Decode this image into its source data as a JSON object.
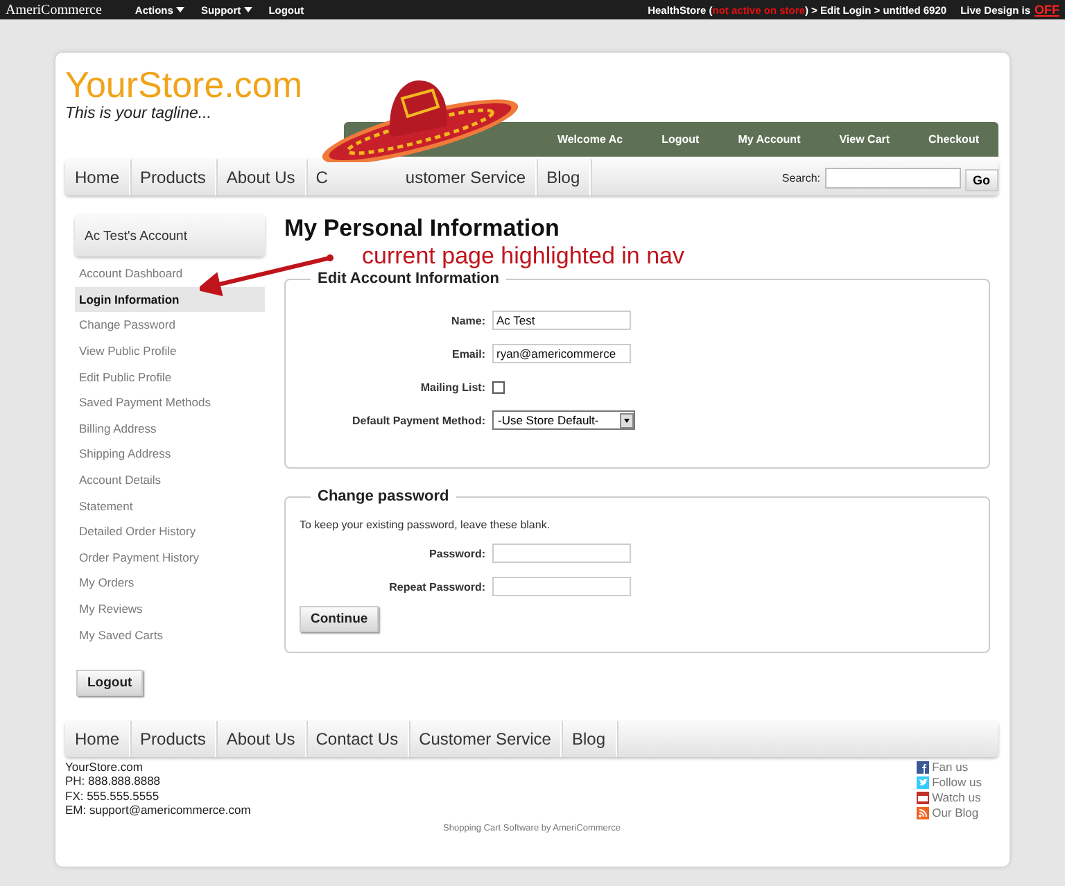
{
  "top_bar": {
    "brand": "AmeriCommerce",
    "menus": [
      {
        "label": "Actions",
        "kind": "dropdown"
      },
      {
        "label": "Support",
        "kind": "dropdown"
      },
      {
        "label": "Logout",
        "kind": "link"
      }
    ],
    "breadcrumb": [
      {
        "text": "HealthStore (",
        "kind": "plain"
      },
      {
        "text": "not active on store",
        "kind": "alert"
      },
      {
        "text": ") > Edit Login > untitled 6920",
        "kind": "plain"
      }
    ],
    "live_design": {
      "label": "Live Design is",
      "value": "OFF"
    }
  },
  "header": {
    "logo": "YourStore.com",
    "tagline": "This is your tagline...",
    "account_links": [
      "Welcome Ac",
      "Logout",
      "My Account",
      "View Cart",
      "Checkout"
    ]
  },
  "nav": {
    "items": [
      "Home",
      "Products",
      "About Us",
      "C",
      "ustomer Service",
      "Blog"
    ],
    "search_label": "Search:",
    "search_button": "Go"
  },
  "sidebar": {
    "title": "Ac Test's Account",
    "items": [
      {
        "label": "Account Dashboard",
        "selected": false
      },
      {
        "label": "Login Information",
        "selected": true
      },
      {
        "label": "Change Password",
        "selected": false
      },
      {
        "label": "View Public Profile",
        "selected": false
      },
      {
        "label": "Edit Public Profile",
        "selected": false
      },
      {
        "label": "Saved Payment Methods",
        "selected": false
      },
      {
        "label": "Billing Address",
        "selected": false
      },
      {
        "label": "Shipping Address",
        "selected": false
      },
      {
        "label": "Account Details",
        "selected": false
      },
      {
        "label": "Statement",
        "selected": false
      },
      {
        "label": "Detailed Order History",
        "selected": false
      },
      {
        "label": "Order Payment History",
        "selected": false
      },
      {
        "label": "My Orders",
        "selected": false
      },
      {
        "label": "My Reviews",
        "selected": false
      },
      {
        "label": "My Saved Carts",
        "selected": false
      }
    ],
    "logout": "Logout"
  },
  "annotation": "current page highlighted in nav",
  "main": {
    "title": "My Personal Information",
    "account_section": {
      "legend": "Edit Account Information",
      "fields": [
        {
          "label": "Name:",
          "kind": "text",
          "value": "Ac Test"
        },
        {
          "label": "Email:",
          "kind": "text",
          "value": "ryan@americommerce"
        },
        {
          "label": "Mailing List:",
          "kind": "checkbox",
          "checked": false
        },
        {
          "label": "Default Payment Method:",
          "kind": "select",
          "value": "-Use Store Default-"
        }
      ]
    },
    "password_section": {
      "legend": "Change password",
      "hint": "To keep your existing password, leave these blank.",
      "fields": [
        {
          "label": "Password:",
          "kind": "password"
        },
        {
          "label": "Repeat Password:",
          "kind": "password"
        }
      ],
      "button": "Continue"
    }
  },
  "footer": {
    "nav": [
      "Home",
      "Products",
      "About Us",
      "Contact Us",
      "Customer Service",
      "Blog"
    ],
    "contact": [
      "YourStore.com",
      "PH: 888.888.8888",
      "FX: 555.555.5555",
      "EM: support@americommerce.com"
    ],
    "social": [
      {
        "label": "Fan us",
        "kind": "facebook"
      },
      {
        "label": "Follow us",
        "kind": "twitter"
      },
      {
        "label": "Watch us",
        "kind": "youtube"
      },
      {
        "label": "Our Blog",
        "kind": "rss"
      }
    ],
    "credit": "Shopping Cart Software by AmeriCommerce"
  }
}
